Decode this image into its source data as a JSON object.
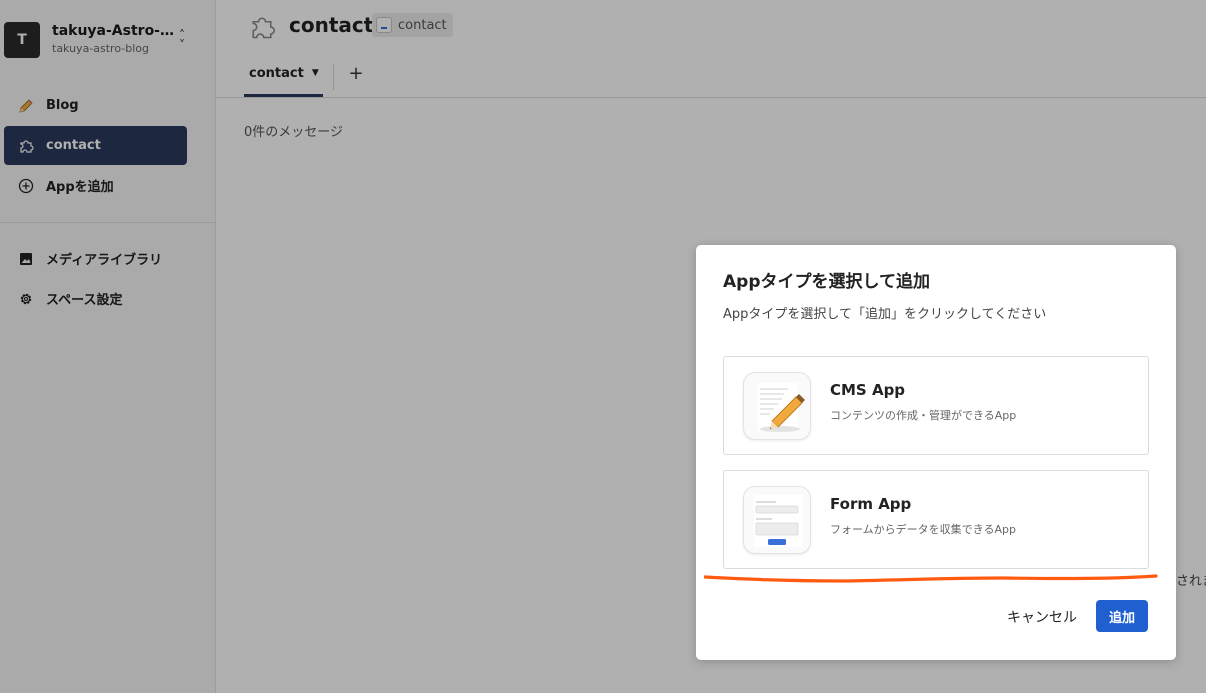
{
  "space": {
    "avatar": "T",
    "name": "takuya-Astro-b...",
    "sub": "takuya-astro-blog",
    "switch_icon": "chevron-up-down-icon"
  },
  "sidebar": {
    "items": [
      {
        "label": "Blog",
        "icon": "pencil-icon",
        "active": false
      },
      {
        "label": "contact",
        "icon": "puzzle-icon",
        "active": true
      },
      {
        "label": "Appを追加",
        "icon": "plus-circle-icon",
        "active": false
      }
    ],
    "bottom_items": [
      {
        "label": "メディアライブラリ",
        "icon": "image-icon"
      },
      {
        "label": "スペース設定",
        "icon": "gear-icon"
      }
    ]
  },
  "header": {
    "title": "contact",
    "badge": "contact",
    "tab_label": "contact",
    "add_tab": "+"
  },
  "main": {
    "message_count": "0件のメッセージ",
    "partial_text": "されま"
  },
  "modal": {
    "title": "Appタイプを選択して追加",
    "description": "Appタイプを選択して「追加」をクリックしてください",
    "options": [
      {
        "title": "CMS App",
        "description": "コンテンツの作成・管理ができるApp",
        "icon": "cms-app-icon"
      },
      {
        "title": "Form App",
        "description": "フォームからデータを収集できるApp",
        "icon": "form-app-icon"
      }
    ],
    "cancel_label": "キャンセル",
    "add_label": "追加"
  },
  "colors": {
    "sidebar_active": "#2b3a5e",
    "primary_button": "#1f5fd0",
    "annotation": "#ff5a10"
  }
}
